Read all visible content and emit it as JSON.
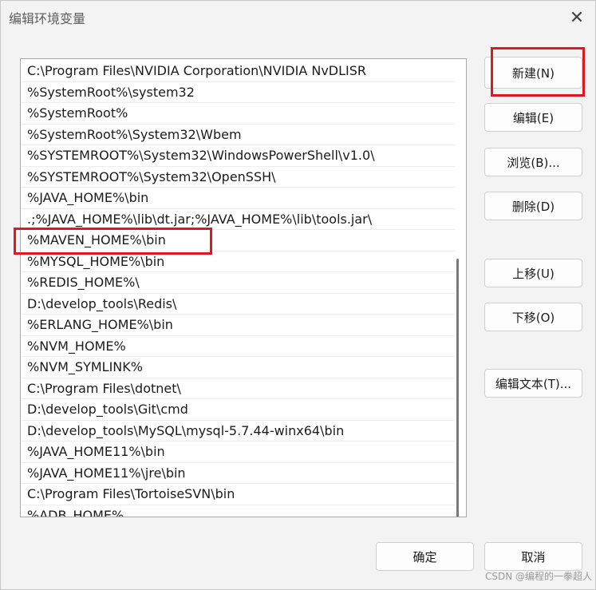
{
  "window": {
    "title": "编辑环境变量",
    "close_glyph": "✕"
  },
  "paths": [
    "C:\\Program Files\\NVIDIA Corporation\\NVIDIA NvDLISR",
    "%SystemRoot%\\system32",
    "%SystemRoot%",
    "%SystemRoot%\\System32\\Wbem",
    "%SYSTEMROOT%\\System32\\WindowsPowerShell\\v1.0\\",
    "%SYSTEMROOT%\\System32\\OpenSSH\\",
    "%JAVA_HOME%\\bin",
    ".;%JAVA_HOME%\\lib\\dt.jar;%JAVA_HOME%\\lib\\tools.jar\\",
    "%MAVEN_HOME%\\bin",
    "%MYSQL_HOME%\\bin",
    "%REDIS_HOME%\\",
    "D:\\develop_tools\\Redis\\",
    "%ERLANG_HOME%\\bin",
    "%NVM_HOME%",
    "%NVM_SYMLINK%",
    "C:\\Program Files\\dotnet\\",
    "D:\\develop_tools\\Git\\cmd",
    "D:\\develop_tools\\MySQL\\mysql-5.7.44-winx64\\bin",
    "%JAVA_HOME11%\\bin",
    "%JAVA_HOME11%\\jre\\bin",
    "C:\\Program Files\\TortoiseSVN\\bin",
    "%ADB_HOME%"
  ],
  "buttons": {
    "new": "新建(N)",
    "edit": "编辑(E)",
    "browse": "浏览(B)...",
    "delete": "删除(D)",
    "move_up": "上移(U)",
    "move_down": "下移(O)",
    "edit_text": "编辑文本(T)...",
    "ok": "确定",
    "cancel": "取消"
  },
  "watermark": "CSDN @编程的一拳超人",
  "colors": {
    "highlight": "#e0171e"
  }
}
